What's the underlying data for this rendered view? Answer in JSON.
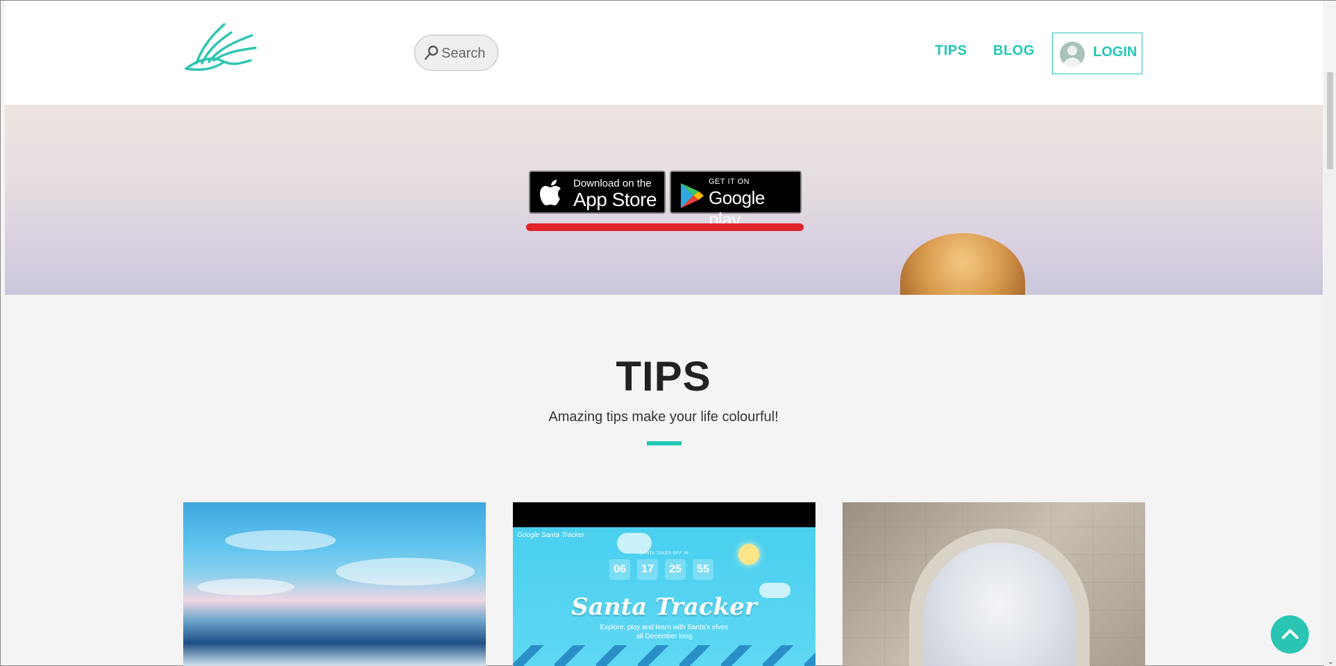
{
  "header": {
    "search_placeholder": "Search",
    "nav": {
      "tips": "TIPS",
      "blog": "BLOG",
      "login": "LOGIN"
    }
  },
  "hero": {
    "app_store": {
      "small": "Download on the",
      "big": "App Store"
    },
    "google_play": {
      "small": "GET IT ON",
      "big": "Google play"
    }
  },
  "tips": {
    "title": "TIPS",
    "subtitle": "Amazing tips make your life colourful!"
  },
  "cards": {
    "santa": {
      "brand": "Google Santa Tracker",
      "caption": "SANTA TAKES OFF IN",
      "countdown": [
        "06",
        "17",
        "25",
        "55"
      ],
      "title": "Santa Tracker",
      "description": "Explore, play and learn with Santa's elves all December long"
    }
  },
  "colors": {
    "accent": "#20c7b5",
    "highlight_underline": "#e0242a",
    "scroll_top": "#2ac4b3"
  },
  "icons": [
    "search-icon",
    "avatar-icon",
    "apple-icon",
    "google-play-icon",
    "chevron-up-icon",
    "bird-logo"
  ]
}
